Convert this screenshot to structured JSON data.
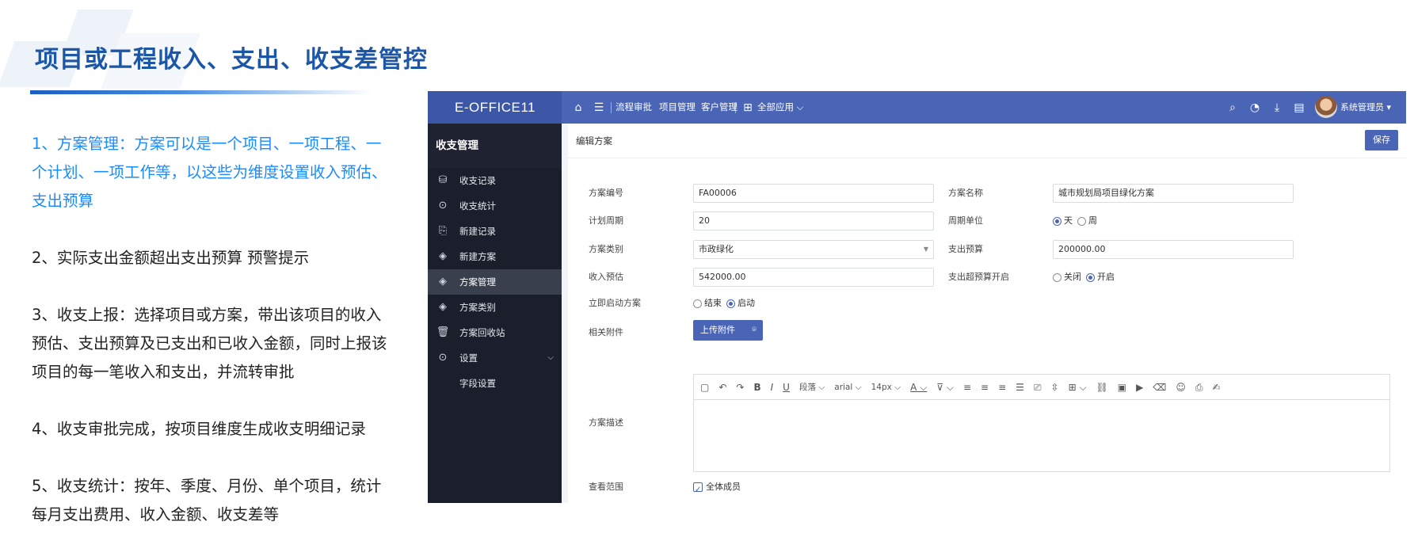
{
  "slide": {
    "title": "项目或工程收入、支出、收支差管控",
    "points": [
      "1、方案管理：方案可以是一个项目、一项工程、一个计划、一项工作等，以这些为维度设置收入预估、支出预算",
      "2、实际支出金额超出支出预算 预警提示",
      "3、收支上报：选择项目或方案，带出该项目的收入预估、支出预算及已支出和已收入金额，同时上报该项目的每一笔收入和支出，并流转审批",
      "4、收支审批完成，按项目维度生成收支明细记录",
      "5、收支统计：按年、季度、月份、单个项目，统计每月支出费用、收入金额、收支差等"
    ]
  },
  "app": {
    "brand": "E-OFFICE11",
    "nav": [
      "流程审批",
      "项目管理",
      "客户管理"
    ],
    "all_apps": "全部应用",
    "user": "系统管理员",
    "accent": "#4a64b6"
  },
  "sidebar": {
    "title": "收支管理",
    "items": [
      {
        "label": "收支记录",
        "icon": "coin-icon"
      },
      {
        "label": "收支统计",
        "icon": "stats-icon"
      },
      {
        "label": "新建记录",
        "icon": "new-record-icon"
      },
      {
        "label": "新建方案",
        "icon": "layers-icon"
      },
      {
        "label": "方案管理",
        "icon": "layers-icon"
      },
      {
        "label": "方案类别",
        "icon": "layers-icon"
      },
      {
        "label": "方案回收站",
        "icon": "trash-icon"
      },
      {
        "label": "设置",
        "icon": "settings-icon"
      },
      {
        "label": "字段设置",
        "icon": ""
      }
    ],
    "active_index": 4
  },
  "form": {
    "page_title": "编辑方案",
    "save_label": "保存",
    "plan_no": {
      "label": "方案编号",
      "value": "FA00006"
    },
    "plan_name": {
      "label": "方案名称",
      "value": "城市规划局项目绿化方案"
    },
    "cycle": {
      "label": "计划周期",
      "value": "20"
    },
    "cycle_unit": {
      "label": "周期单位",
      "options": [
        "天",
        "周"
      ],
      "selected": "天"
    },
    "category": {
      "label": "方案类别",
      "value": "市政绿化"
    },
    "budget": {
      "label": "支出预算",
      "value": "200000.00"
    },
    "income": {
      "label": "收入预估",
      "value": "542000.00"
    },
    "over_budget": {
      "label": "支出超预算开启",
      "options": [
        "关闭",
        "开启"
      ],
      "selected": "开启"
    },
    "start_now": {
      "label": "立即启动方案",
      "options": [
        "结束",
        "启动"
      ],
      "selected": "启动"
    },
    "attachment": {
      "label": "相关附件",
      "button": "上传附件"
    },
    "description": {
      "label": "方案描述"
    },
    "scope": {
      "label": "查看范围",
      "value": "全体成员"
    }
  },
  "editor_toolbar": {
    "paragraph": "段落",
    "font": "arial",
    "size": "14px"
  }
}
